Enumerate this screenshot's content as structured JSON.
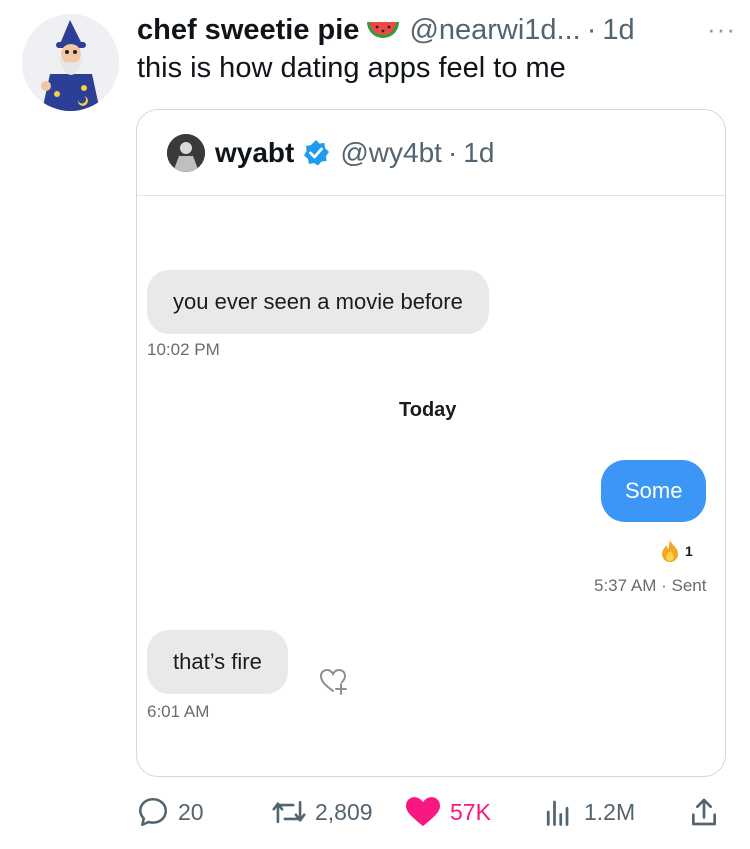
{
  "tweet": {
    "display_name": "chef sweetie pie",
    "emoji_icon": "watermelon-icon",
    "handle": "@nearwi1d...",
    "separator": "·",
    "time": "1d",
    "more_label": "···",
    "text": "this is how dating apps feel to me"
  },
  "quote": {
    "display_name": "wyabt",
    "handle": "@wy4bt",
    "separator": "·",
    "time": "1d",
    "verified_color": "#1d9bf0",
    "messages": {
      "msg1_text": "you ever seen a movie before",
      "msg1_time": "10:02 PM",
      "day_separator": "Today",
      "msg2_text": "Some",
      "reaction_count": "1",
      "msg2_status": "5:37 AM · Sent",
      "msg3_text": "that’s fire",
      "msg3_time": "6:01 AM"
    }
  },
  "actions": {
    "replies": "20",
    "retweets": "2,809",
    "likes": "57K",
    "views": "1.2M"
  },
  "colors": {
    "like_pink": "#f91880",
    "imessage_blue": "#3b96f5",
    "imessage_gray": "#e9e9eb",
    "secondary_text": "#536471"
  }
}
